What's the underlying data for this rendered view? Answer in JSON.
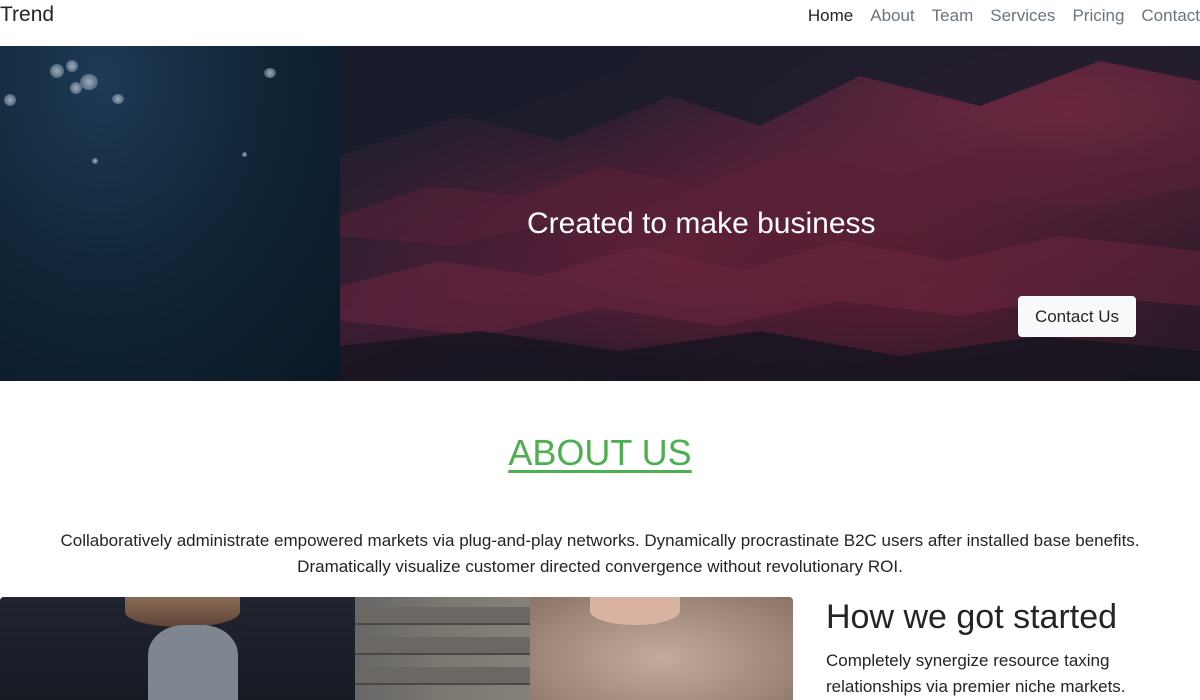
{
  "navbar": {
    "brand": "Trend",
    "links": [
      "Home",
      "About",
      "Team",
      "Services",
      "Pricing",
      "Contact"
    ],
    "active": "Home"
  },
  "hero": {
    "title": "Created to make business",
    "button_label": "Contact Us"
  },
  "about": {
    "title": "ABOUT US",
    "text_line1": "Collaboratively administrate empowered markets via plug-and-play networks. Dynamically procrastinate B2C users after installed base benefits.",
    "text_line2": "Dramatically visualize customer directed convergence without revolutionary ROI."
  },
  "started": {
    "title": "How we got started",
    "text": "Completely synergize resource taxing relationships via premier niche markets."
  },
  "colors": {
    "accent_green": "#4caf50",
    "text": "#212529",
    "muted": "#6c757d"
  }
}
